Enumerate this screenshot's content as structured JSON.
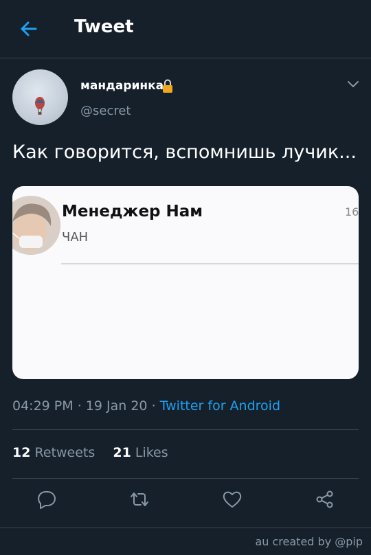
{
  "header": {
    "title": "Tweet",
    "back_icon": "arrow-left-icon"
  },
  "tweet": {
    "author": {
      "display_name": "мандаринка",
      "handle": "@secret",
      "protected_icon": "lock-icon"
    },
    "text": "Как говорится, вспомнишь лучик...",
    "media": {
      "contact_name": "Менеджер Нам",
      "contact_subtitle": "ЧАН",
      "time_fragment": "16"
    },
    "time": "04:29 PM",
    "date": "19 Jan 20",
    "source": "Twitter for Android",
    "retweets": "12",
    "retweets_label": "Retweets",
    "likes": "21",
    "likes_label": "Likes"
  },
  "actions": {
    "reply_icon": "reply-icon",
    "retweet_icon": "retweet-icon",
    "like_icon": "heart-icon",
    "share_icon": "share-icon"
  },
  "credit": "au created by @pip",
  "colors": {
    "background": "#15202b",
    "accent": "#1da1f2",
    "muted": "#8899a6",
    "border": "#38444d"
  }
}
